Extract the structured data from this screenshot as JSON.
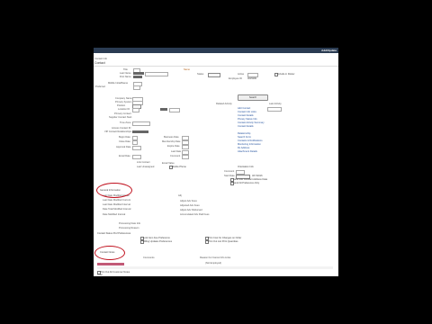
{
  "app": {
    "title": "Add/Update"
  },
  "header": {
    "breadcrumb": "Contact Info",
    "title": "Contact"
  },
  "topRight": {
    "status_label": "Status",
    "status_value": "Active",
    "id_label": "Employee ID",
    "id_value": "0035080",
    "include_label": "Include in Roster"
  },
  "name_label": "Name",
  "left_fields": [
    "Title",
    "Last Name",
    "First Name",
    "Middle Initial/Name",
    "Preferred",
    "Suffix"
  ],
  "mid_fields": [
    "Company Name",
    "Primary System",
    "Position",
    "Location ID",
    "Primary Contact",
    "Supplier Contact Start",
    "Time Zone",
    "Access Contact ID",
    "VIP Contact Relationships",
    "Begin Date",
    "Close Date",
    "Approval Date"
  ],
  "right_block": {
    "button": "Search",
    "labels": [
      "Related Activity",
      "Last Activity"
    ],
    "links": [
      "Add Contact",
      "Contact Info Links",
      "Contact Details",
      "Privacy Status Info",
      "Contact Activity Summary",
      "Contact Details",
      "Relationship",
      "Search Form",
      "Contacts & Notifications",
      "Monitoring Information",
      "Rx Address",
      "Attachment Details"
    ]
  },
  "mid_right_fields": [
    "Business Date",
    "Membership Date",
    "Expire Date",
    "Last Date",
    "Comment",
    "Email Value"
  ],
  "mid_lower": [
    "Email Date",
    "Link Contact",
    "Last Unassigned"
  ],
  "mid_lower_right": [
    "Mobile Phone",
    "Mobile Email"
  ],
  "lower_right": {
    "title": "Orientation Info",
    "fields": [
      "Comment",
      "Start Date"
    ],
    "start_value": "3/17/2016",
    "options": [
      "Send Info Contract Address Data",
      "Send All Preference-Only"
    ]
  },
  "section1": {
    "title": "General Information",
    "fields": [
      "Last Date Modified Actual",
      "Last Date Modified Current",
      "Last Date Modified Interval",
      "Date Total Modified Interval",
      "Date Modified Interval"
    ],
    "right_fields": [
      "Adj",
      "Adjust Adv Fees",
      "Adjusted Adv Fees",
      "Adjust Adv Disbursed",
      "Accumulated Adv Paid Fees"
    ]
  },
  "section2": {
    "fields": [
      "Processing Date Info",
      "Processing Reason"
    ]
  },
  "contact_prefs": "Contact Status Pref Preferences",
  "checks": [
    "Lock Item Fee Preference",
    "Billing Updates Preferences",
    "Print Cost for Changes on Order",
    "Print Out List Print Quantities"
  ],
  "section3": {
    "title": "Contact Notes",
    "label": "Comments",
    "right_label": "Reason For Cancel Info Links",
    "check": "Print Out All Customer Notes",
    "placeholder": "(Not Employed)"
  },
  "footer": {
    "text": "Total"
  }
}
